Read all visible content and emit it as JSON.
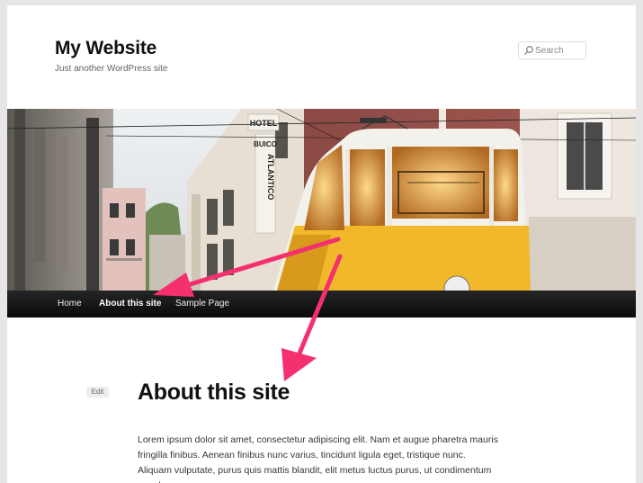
{
  "header": {
    "site_title": "My Website",
    "site_description": "Just another WordPress site",
    "search_placeholder": "Search"
  },
  "header_image": {
    "signs": [
      "HOTEL",
      "BUICO",
      "ATLANTICO"
    ]
  },
  "nav": {
    "items": [
      {
        "label": "Home",
        "current": false
      },
      {
        "label": "About this site",
        "current": true
      },
      {
        "label": "Sample Page",
        "current": false
      }
    ]
  },
  "entry": {
    "edit_label": "Edit",
    "title": "About this site",
    "content": "Lorem ipsum dolor sit amet, consectetur adipiscing elit. Nam et augue pharetra mauris fringilla finibus. Aenean finibus nunc varius, tincidunt ligula eget, tristique nunc. Aliquam vulputate, purus quis mattis blandit, elit metus luctus purus, ut condimentum eros lacus"
  },
  "colors": {
    "annotation_arrow": "#f4306f",
    "navbar": "#111111",
    "tram_yellow": "#f1b92a"
  }
}
